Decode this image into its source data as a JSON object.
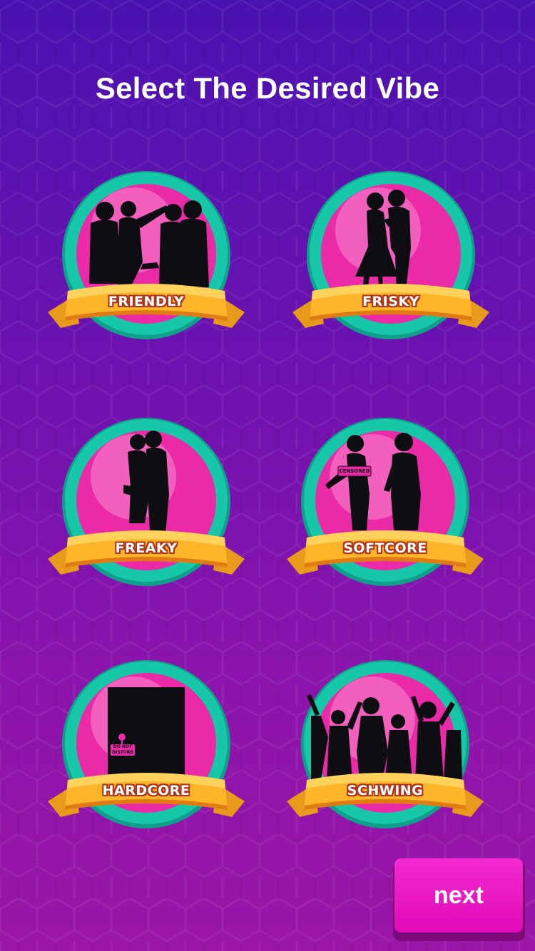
{
  "screen": {
    "title": "Select The Desired Vibe"
  },
  "vibes": [
    {
      "label": "FRIENDLY",
      "icon": "group-silhouette-icon"
    },
    {
      "label": "FRISKY",
      "icon": "couple-embrace-silhouette-icon"
    },
    {
      "label": "FREAKY",
      "icon": "couple-kiss-silhouette-icon"
    },
    {
      "label": "SOFTCORE",
      "icon": "couple-censored-silhouette-icon",
      "sticker_text": "CENSORED"
    },
    {
      "label": "HARDCORE",
      "icon": "closed-door-icon",
      "sticker_text": "DO NOT DISTURB"
    },
    {
      "label": "SCHWING",
      "icon": "party-crowd-silhouette-icon"
    }
  ],
  "actions": {
    "next_label": "next"
  },
  "colors": {
    "background_top": "#4a12b0",
    "background_bottom": "#9a16a6",
    "badge_ring": "#16c7a8",
    "badge_inner": "#ea2aa6",
    "ribbon": "#ffb52a",
    "button": "#e10ab8"
  }
}
